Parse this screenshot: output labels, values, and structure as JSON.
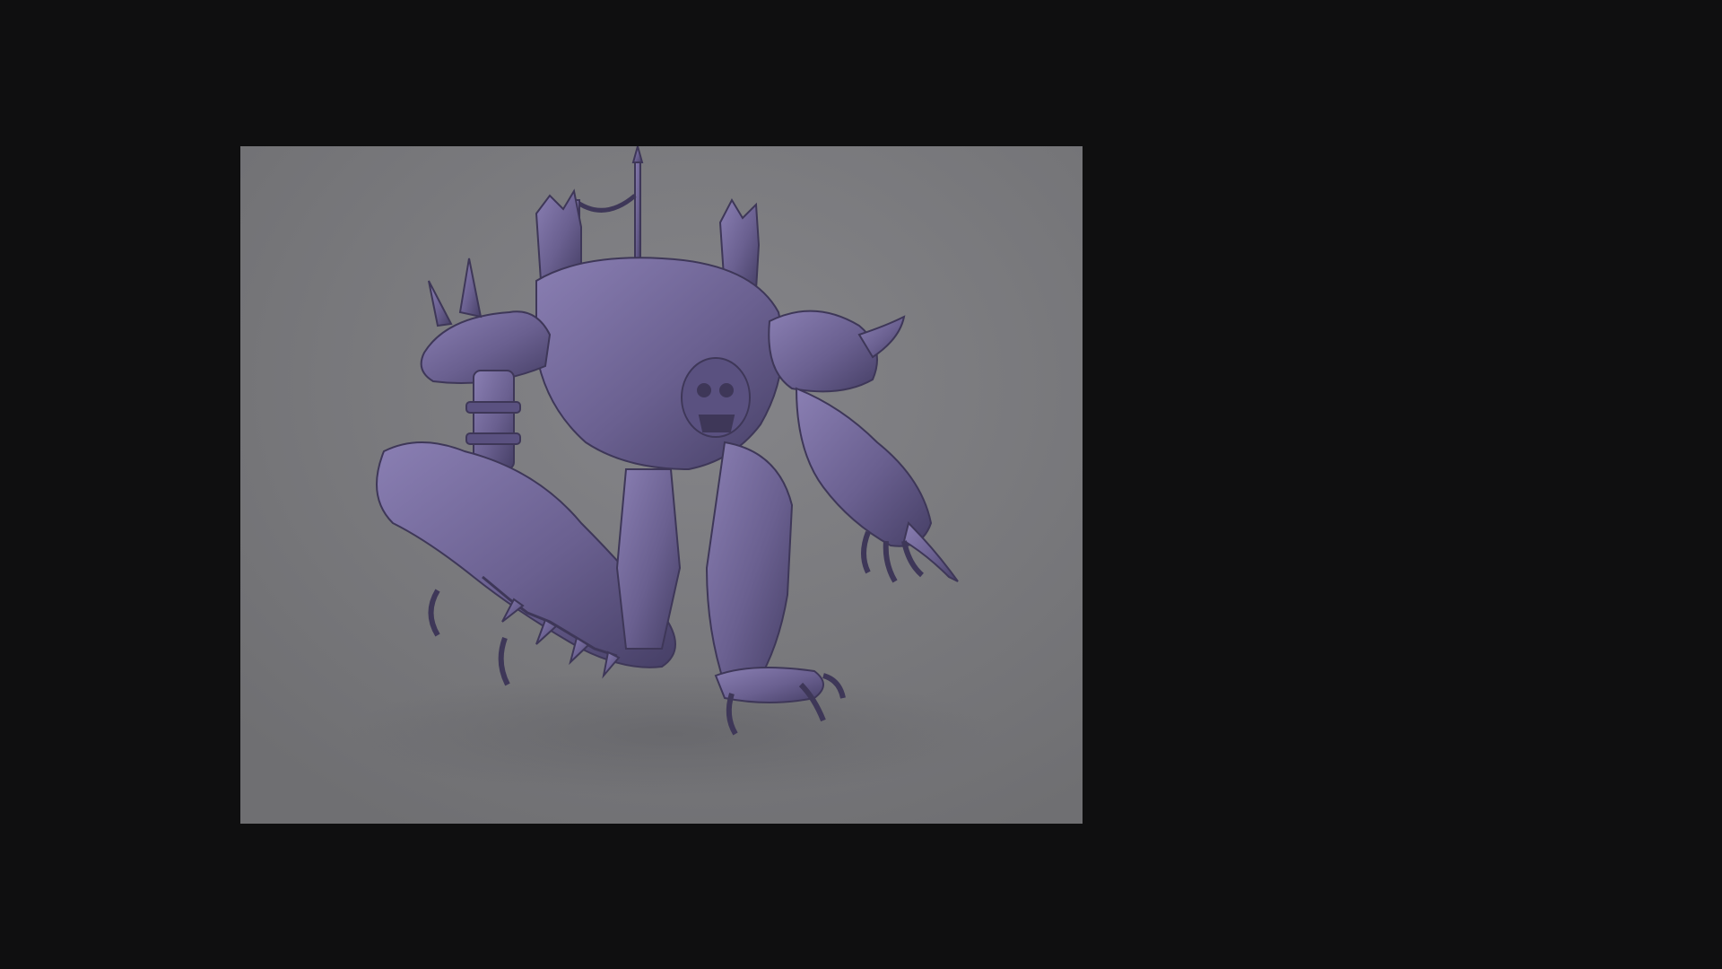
{
  "viewer": {
    "background_color": "#0f0f10",
    "stage_color": "#7b7b7e"
  },
  "model": {
    "color": "#6a6090",
    "highlight": "#8a7fb3",
    "shadow": "#3e3758"
  }
}
